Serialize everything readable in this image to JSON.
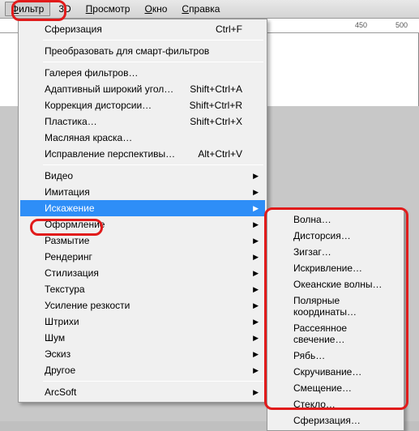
{
  "menubar": {
    "filter": "Фильтр",
    "threeD": "3D",
    "view": "Просмотр",
    "window": "Окно",
    "help": "Справка"
  },
  "ruler": {
    "m450": "450",
    "m500": "500"
  },
  "menu": {
    "repeat_last": "Сферизация",
    "repeat_shortcut": "Ctrl+F",
    "convert_smart": "Преобразовать для смарт-фильтров",
    "gallery": "Галерея фильтров…",
    "wide_angle": "Адаптивный широкий угол…",
    "wide_angle_sc": "Shift+Ctrl+A",
    "lens_corr": "Коррекция дисторсии…",
    "lens_corr_sc": "Shift+Ctrl+R",
    "liquify": "Пластика…",
    "liquify_sc": "Shift+Ctrl+X",
    "oil_paint": "Масляная краска…",
    "vanishing": "Исправление перспективы…",
    "vanishing_sc": "Alt+Ctrl+V",
    "video": "Видео",
    "imitation": "Имитация",
    "distort": "Искажение",
    "styling": "Оформление",
    "blur": "Размытие",
    "render": "Рендеринг",
    "stylize": "Стилизация",
    "texture": "Текстура",
    "sharpen": "Усиление резкости",
    "strokes": "Штрихи",
    "noise": "Шум",
    "sketch": "Эскиз",
    "other": "Другое",
    "arcsoft": "ArcSoft"
  },
  "submenu": {
    "wave": "Волна…",
    "distortion": "Дисторсия…",
    "zigzag": "Зигзаг…",
    "twirl": "Искривление…",
    "ocean": "Океанские волны…",
    "polar": "Полярные координаты…",
    "diffuse": "Рассеянное свечение…",
    "ripple": "Рябь…",
    "twist": "Скручивание…",
    "displace": "Смещение…",
    "glass": "Стекло…",
    "spherize": "Сферизация…"
  }
}
